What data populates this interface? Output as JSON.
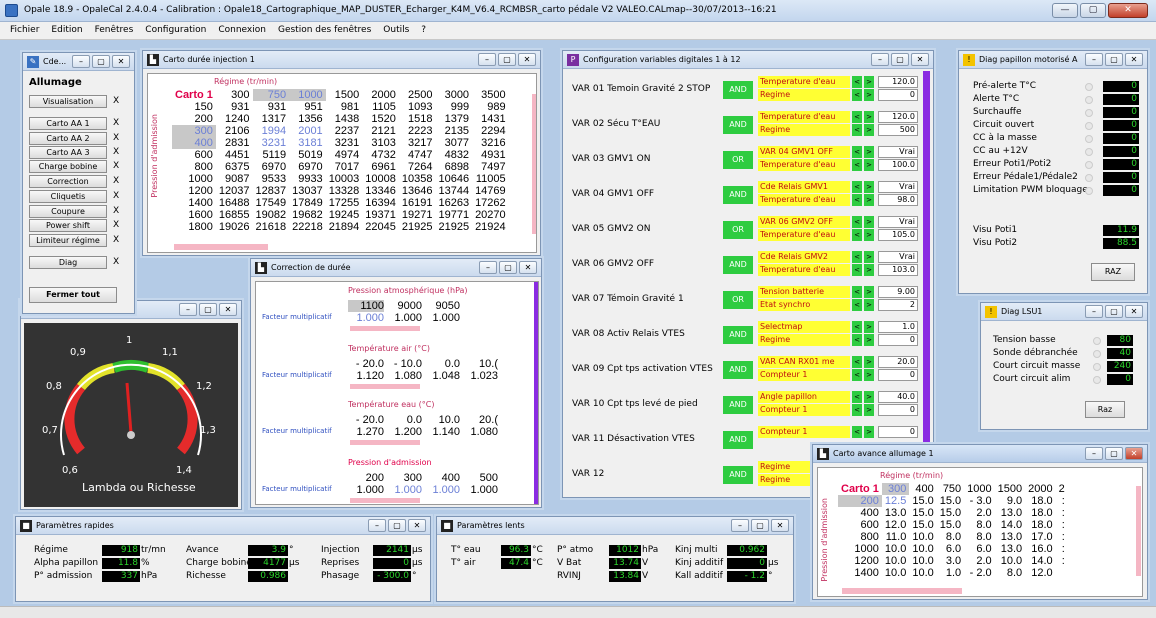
{
  "app": {
    "title": "Opale 18.9 - OpaleCal 2.4.0.4 - Calibration : Opale18_Cartographique_MAP_DUSTER_Echarger_K4M_V6.4_RCMBSR_carto pédale V2 VALEO.CALmap--30/07/2013--16:21"
  },
  "window_controls": {
    "minimize": "—",
    "maximize": "▢",
    "close": "✕"
  },
  "menu": [
    "Fichier",
    "Edition",
    "Fenêtres",
    "Configuration",
    "Connexion",
    "Gestion des fenêtres",
    "Outils",
    "?"
  ],
  "allumage": {
    "win_title": "Cde...",
    "heading": "Allumage",
    "items": [
      "Visualisation",
      "Carto AA 1",
      "Carto AA 2",
      "Carto AA 3",
      "Charge bobine",
      "Correction",
      "Cliquetis",
      "Coupure",
      "Power shift",
      "Limiteur régime",
      "Diag"
    ],
    "x": "X",
    "close_all": "Fermer tout"
  },
  "carto_inj": {
    "title": "Carto durée injection 1",
    "x_title": "Régime (tr/min)",
    "y_title": "Pression d'admission",
    "corner": "Carto 1",
    "cols": [
      "300",
      "750",
      "1000",
      "1500",
      "2000",
      "2500",
      "3000",
      "3500"
    ],
    "rows": [
      [
        "150",
        "931",
        "931",
        "951",
        "981",
        "1105",
        "1093",
        "999",
        "989"
      ],
      [
        "200",
        "1240",
        "1317",
        "1356",
        "1438",
        "1520",
        "1518",
        "1379",
        "1431"
      ],
      [
        "300",
        "2106",
        "1994",
        "2001",
        "2237",
        "2121",
        "2223",
        "2135",
        "2294"
      ],
      [
        "400",
        "2831",
        "3231",
        "3181",
        "3231",
        "3103",
        "3217",
        "3077",
        "3216"
      ],
      [
        "600",
        "4451",
        "5119",
        "5019",
        "4974",
        "4732",
        "4747",
        "4832",
        "4931"
      ],
      [
        "800",
        "6375",
        "6970",
        "6970",
        "7017",
        "6961",
        "7264",
        "6898",
        "7497"
      ],
      [
        "1000",
        "9087",
        "9533",
        "9933",
        "10003",
        "10008",
        "10358",
        "10646",
        "11005"
      ],
      [
        "1200",
        "12037",
        "12837",
        "13037",
        "13328",
        "13346",
        "13646",
        "13744",
        "14769"
      ],
      [
        "1400",
        "16488",
        "17549",
        "17849",
        "17255",
        "16394",
        "16191",
        "16263",
        "17262"
      ],
      [
        "1600",
        "16855",
        "19082",
        "19682",
        "19245",
        "19371",
        "19271",
        "19771",
        "20270"
      ],
      [
        "1800",
        "19026",
        "21618",
        "22218",
        "21894",
        "22045",
        "21925",
        "21925",
        "21924"
      ]
    ]
  },
  "correction": {
    "title": "Correction de durée",
    "factor_label": "Facteur multiplicatif",
    "blocks": [
      {
        "title": "Pression atmosphérique (hPa)",
        "axis": [
          "1100",
          "9000",
          "9050"
        ],
        "vals": [
          "1.000",
          "1.000",
          "1.000"
        ]
      },
      {
        "title": "Température air (°C)",
        "axis": [
          "- 20.0",
          "- 10.0",
          "0.0",
          "10.("
        ],
        "vals": [
          "1.120",
          "1.080",
          "1.048",
          "1.023"
        ]
      },
      {
        "title": "Température eau (°C)",
        "axis": [
          "- 20.0",
          "0.0",
          "10.0",
          "20.("
        ],
        "vals": [
          "1.270",
          "1.200",
          "1.140",
          "1.080"
        ]
      },
      {
        "title": "Pression d'admission",
        "axis": [
          "200",
          "300",
          "400",
          "500"
        ],
        "vals": [
          "1.000",
          "1.000",
          "1.000",
          "1.000"
        ]
      }
    ]
  },
  "lambda": {
    "label": "Lambda ou Richesse",
    "ticks": [
      "0,6",
      "0,7",
      "0,8",
      "0,9",
      "1",
      "1,1",
      "1,2",
      "1,3",
      "1,4"
    ]
  },
  "digital": {
    "title": "Configuration variables digitales 1 à 12",
    "rows": [
      {
        "name": "VAR 01 Temoin Gravité 2 STOP",
        "op": "AND",
        "a": "Temperature d'eau",
        "b": "Regime",
        "va": "120.0",
        "vb": "0"
      },
      {
        "name": "VAR 02 Sécu T°EAU",
        "op": "AND",
        "a": "Temperature d'eau",
        "b": "Regime",
        "va": "120.0",
        "vb": "500"
      },
      {
        "name": "VAR 03 GMV1 ON",
        "op": "OR",
        "a": "VAR 04 GMV1 OFF",
        "b": "Temperature d'eau",
        "va": "Vrai",
        "vb": "100.0"
      },
      {
        "name": "VAR 04 GMV1 OFF",
        "op": "AND",
        "a": "Cde Relais GMV1",
        "b": "Temperature d'eau",
        "va": "Vrai",
        "vb": "98.0"
      },
      {
        "name": "VAR 05 GMV2 ON",
        "op": "OR",
        "a": "VAR 06 GMV2 OFF",
        "b": "Temperature d'eau",
        "va": "Vrai",
        "vb": "105.0"
      },
      {
        "name": "VAR 06 GMV2 OFF",
        "op": "AND",
        "a": "Cde Relais GMV2",
        "b": "Temperature d'eau",
        "va": "Vrai",
        "vb": "103.0"
      },
      {
        "name": "VAR 07 Témoin Gravité 1",
        "op": "OR",
        "a": "Tension batterie",
        "b": "Etat synchro",
        "va": "9.00",
        "vb": "2"
      },
      {
        "name": "VAR 08 Activ Relais VTES",
        "op": "AND",
        "a": "Selectmap",
        "b": "Regime",
        "va": "1.0",
        "vb": "0"
      },
      {
        "name": "VAR 09 Cpt tps activation VTES",
        "op": "AND",
        "a": "VAR CAN RX01 me",
        "b": "Compteur 1",
        "va": "20.0",
        "vb": "0"
      },
      {
        "name": "VAR 10 Cpt tps levé de pied",
        "op": "AND",
        "a": "Angle papillon",
        "b": "Compteur 1",
        "va": "40.0",
        "vb": "0"
      },
      {
        "name": "VAR 11 Désactivation VTES",
        "op": "AND",
        "a": "Compteur 1",
        "b": "",
        "va": "0",
        "vb": ""
      },
      {
        "name": "VAR 12",
        "op": "AND",
        "a": "Regime",
        "b": "Regime",
        "va": "",
        "vb": ""
      }
    ],
    "cmp_lt": "<",
    "cmp_gt": ">"
  },
  "diag_pap": {
    "title": "Diag papillon motorisé A",
    "rows": [
      [
        "Pré-alerte T°C",
        "0"
      ],
      [
        "Alerte T°C",
        "0"
      ],
      [
        "Surchauffe",
        "0"
      ],
      [
        "Circuit ouvert",
        "0"
      ],
      [
        "CC à la masse",
        "0"
      ],
      [
        "CC au +12V",
        "0"
      ],
      [
        "Erreur Poti1/Poti2",
        "0"
      ],
      [
        "Erreur Pédale1/Pédale2",
        "0"
      ],
      [
        "Limitation PWM bloquage",
        "0"
      ]
    ],
    "visu": [
      [
        "Visu Poti1",
        "11.9"
      ],
      [
        "Visu Poti2",
        "88.5"
      ]
    ],
    "raz": "RAZ"
  },
  "diag_lsu": {
    "title": "Diag LSU1",
    "rows": [
      [
        "Tension basse",
        "80"
      ],
      [
        "Sonde débranchée",
        "40"
      ],
      [
        "Court circuit masse",
        "240"
      ],
      [
        "Court circuit alim",
        "0"
      ]
    ],
    "raz": "Raz"
  },
  "avance": {
    "title": "Carto avance allumage 1",
    "x_title": "Régime (tr/min)",
    "y_title": "Pression d'admission",
    "corner": "Carto 1",
    "cols": [
      "300",
      "400",
      "750",
      "1000",
      "1500",
      "2000",
      "2"
    ],
    "rows": [
      [
        "200",
        "12.5",
        "15.0",
        "15.0",
        "- 3.0",
        "9.0",
        "18.0",
        ":"
      ],
      [
        "400",
        "13.0",
        "15.0",
        "15.0",
        "2.0",
        "13.0",
        "18.0",
        ":"
      ],
      [
        "600",
        "12.0",
        "15.0",
        "15.0",
        "8.0",
        "14.0",
        "18.0",
        ":"
      ],
      [
        "800",
        "11.0",
        "10.0",
        "8.0",
        "8.0",
        "13.0",
        "17.0",
        ":"
      ],
      [
        "1000",
        "10.0",
        "10.0",
        "6.0",
        "6.0",
        "13.0",
        "16.0",
        ":"
      ],
      [
        "1200",
        "10.0",
        "10.0",
        "3.0",
        "2.0",
        "10.0",
        "14.0",
        ":"
      ],
      [
        "1400",
        "10.0",
        "10.0",
        "1.0",
        "- 2.0",
        "8.0",
        "12.0",
        ""
      ]
    ]
  },
  "rapides": {
    "title": "Paramètres rapides",
    "c1": [
      [
        "Régime",
        "918",
        "tr/mn"
      ],
      [
        "Alpha papillon",
        "11.8",
        "%"
      ],
      [
        "P° admission",
        "337",
        "hPa"
      ]
    ],
    "c2": [
      [
        "Avance",
        "3.9",
        "°"
      ],
      [
        "Charge bobine",
        "4177",
        "µs"
      ],
      [
        "Richesse",
        "0.986",
        ""
      ]
    ],
    "c3": [
      [
        "Injection",
        "2141",
        "µs"
      ],
      [
        "Reprises",
        "0",
        "µs"
      ],
      [
        "Phasage",
        "- 300.0",
        "°"
      ]
    ]
  },
  "lents": {
    "title": "Paramètres lents",
    "c1": [
      [
        "T° eau",
        "96.3",
        "°C"
      ],
      [
        "T° air",
        "47.4",
        "°C"
      ]
    ],
    "c2": [
      [
        "P° atmo",
        "1012",
        "hPa"
      ],
      [
        "V Bat",
        "13.74",
        "V"
      ],
      [
        "RVINJ",
        "13.84",
        "V"
      ]
    ],
    "c3": [
      [
        "Kinj multi",
        "0.962",
        ""
      ],
      [
        "Kinj additif",
        "0",
        "µs"
      ],
      [
        "Kall additif",
        "- 1.2",
        "°"
      ]
    ]
  },
  "colors": {
    "green": "#2ecc40",
    "yellow": "#ffff33",
    "lcd_green": "#2bd52b",
    "purple": "#8a2be2",
    "pink": "#f5b6c4"
  }
}
